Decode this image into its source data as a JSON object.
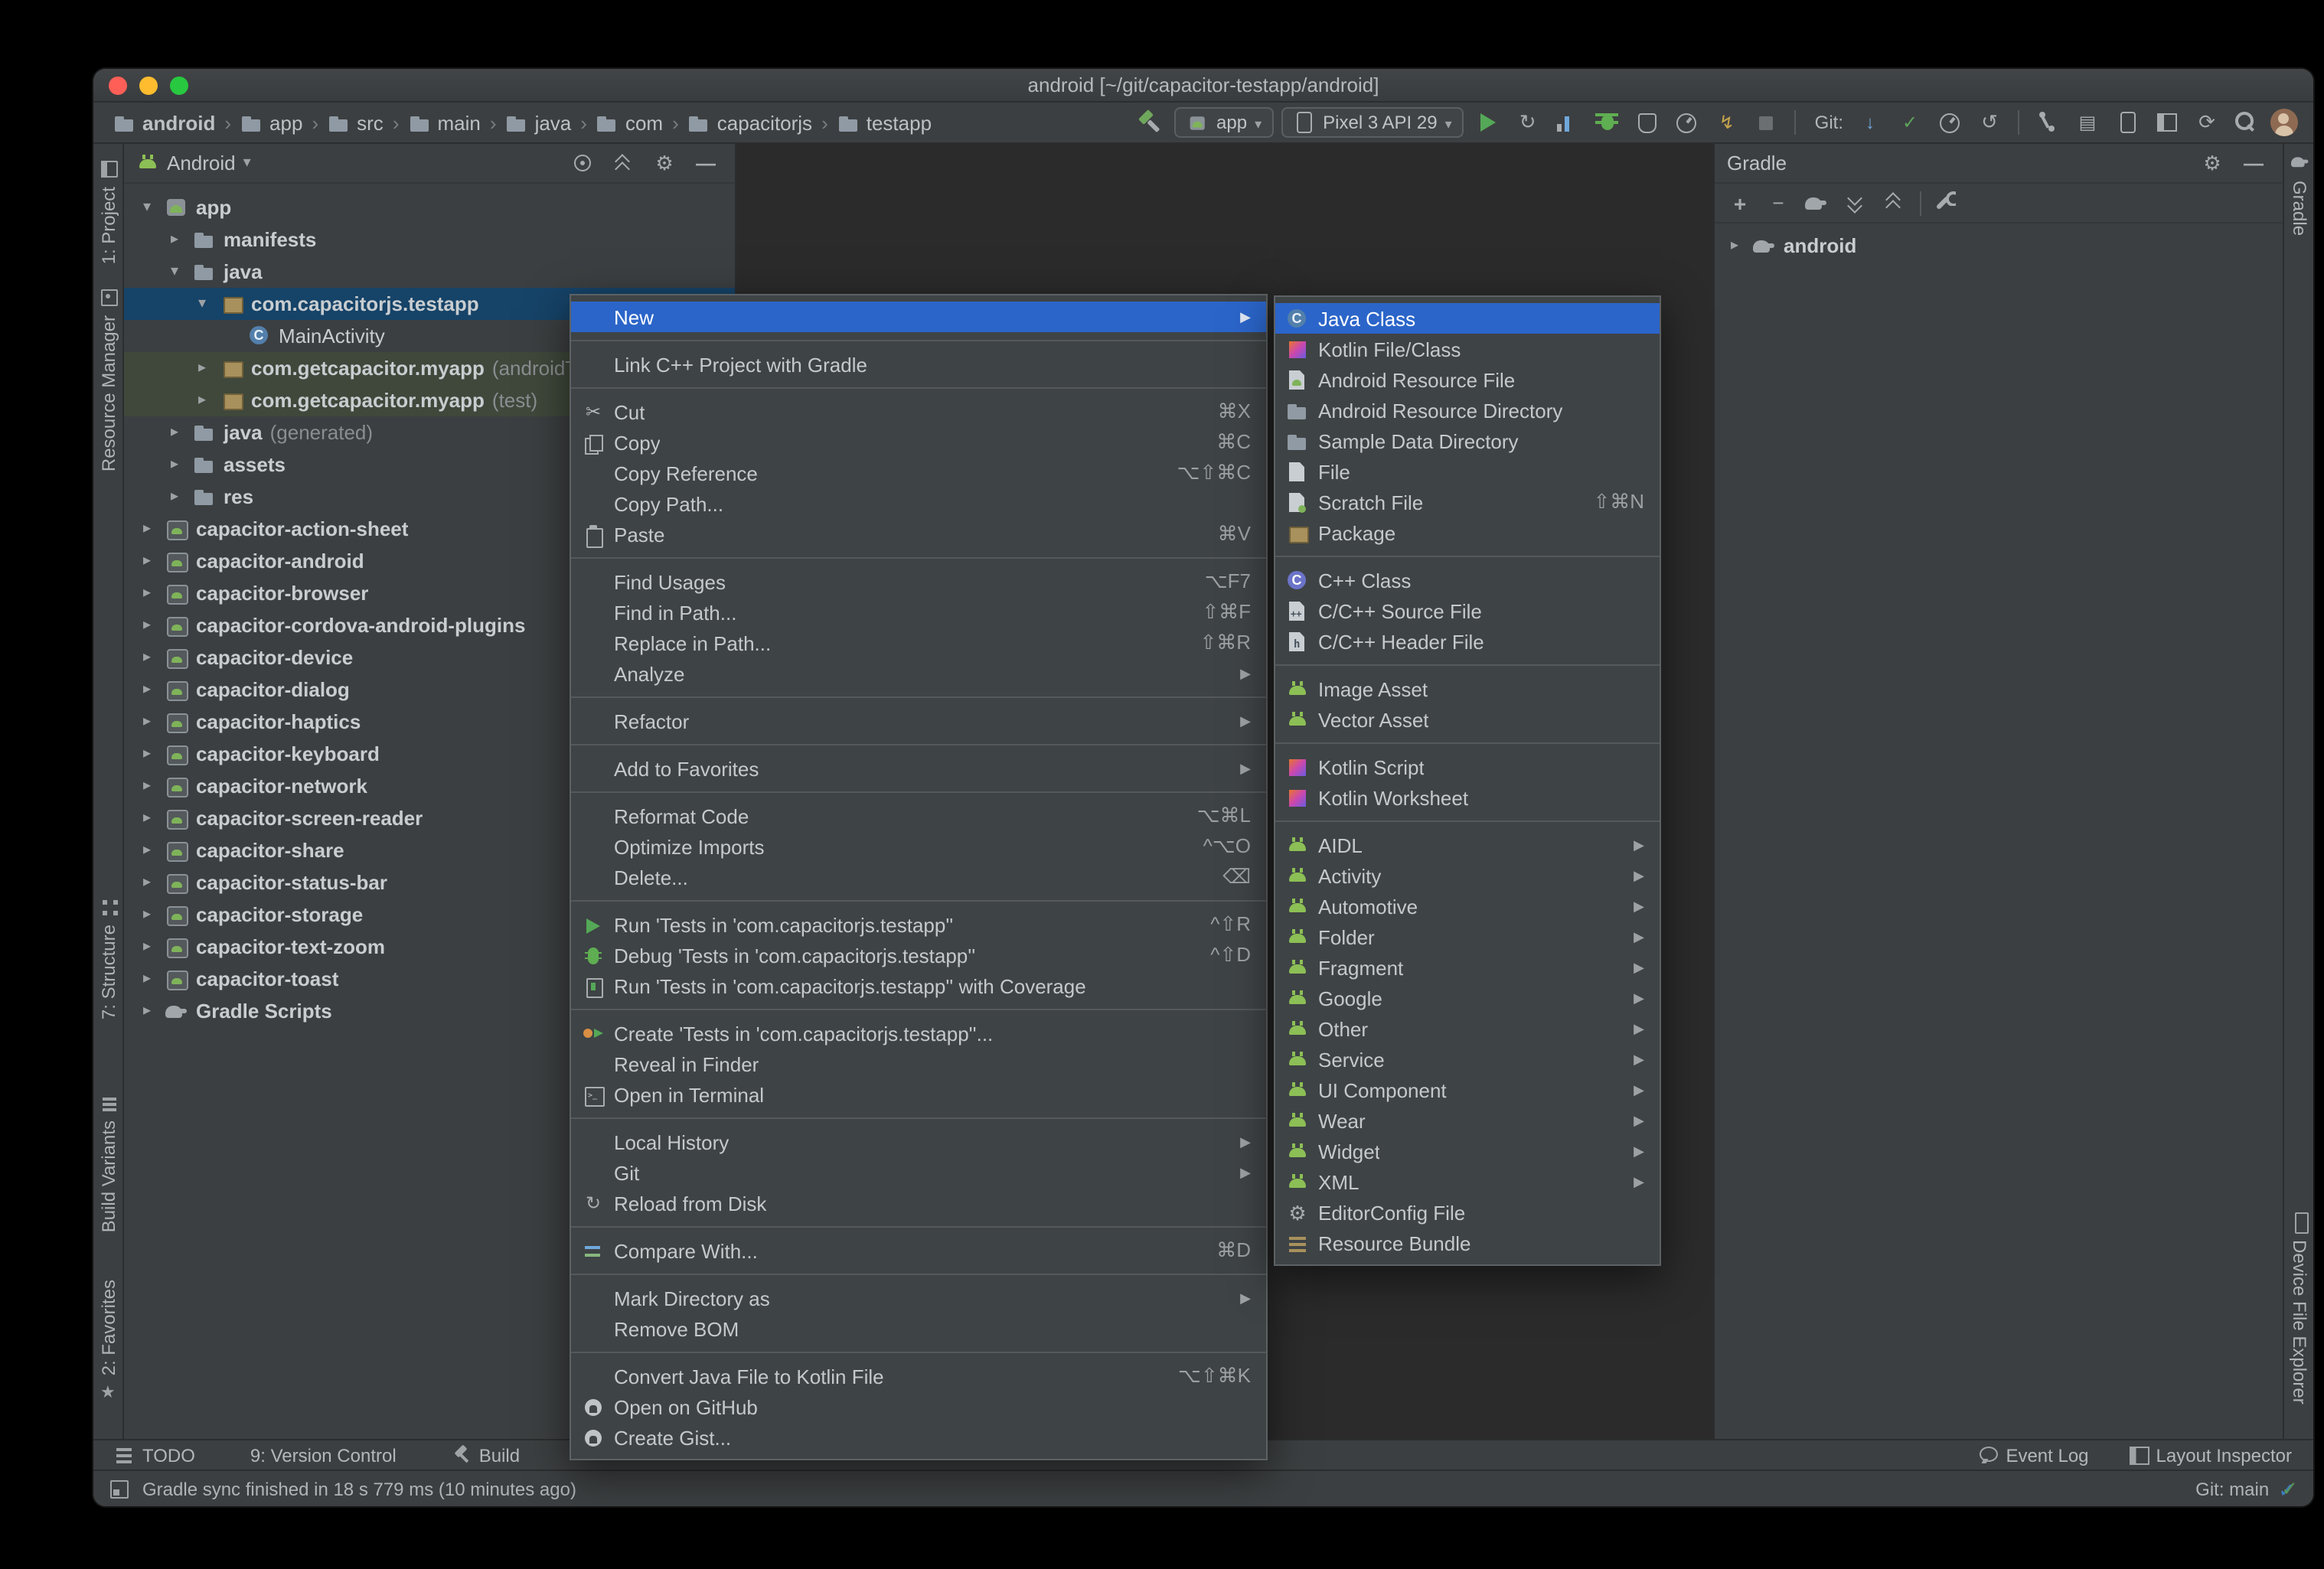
{
  "window": {
    "title": "android [~/git/capacitor-testapp/android]"
  },
  "glyphs": {
    "chevron": "›",
    "caret_down": "▾",
    "expanded": "▾",
    "collapsed": "▸",
    "submenu": "▶"
  },
  "breadcrumbs": [
    "android",
    "app",
    "src",
    "main",
    "java",
    "com",
    "capacitorjs",
    "testapp"
  ],
  "toolbar": {
    "run_config_label": "app",
    "device_label": "Pixel 3 API 29",
    "git_label": "Git:"
  },
  "left_stripe": {
    "project": "1: Project",
    "resource_manager": "Resource Manager",
    "structure": "7: Structure",
    "build_variants": "Build Variants",
    "favorites": "2: Favorites"
  },
  "right_stripe": {
    "gradle": "Gradle",
    "device_file_explorer": "Device File Explorer"
  },
  "project_panel": {
    "view_selector": "Android",
    "tree": [
      {
        "label": "app",
        "level": 0,
        "arrow": "down",
        "icon": "app-module",
        "bold": true
      },
      {
        "label": "manifests",
        "level": 1,
        "arrow": "right",
        "icon": "folder",
        "bold": true
      },
      {
        "label": "java",
        "level": 1,
        "arrow": "down",
        "icon": "folder",
        "bold": true
      },
      {
        "label": "com.capacitorjs.testapp",
        "level": 2,
        "arrow": "down",
        "icon": "package",
        "bold": true,
        "selected": true
      },
      {
        "label": "MainActivity",
        "level": 3,
        "arrow": "none",
        "icon": "class",
        "bold": false
      },
      {
        "label": "com.getcapacitor.myapp",
        "suffix": " (androidTest)",
        "level": 2,
        "arrow": "right",
        "icon": "package",
        "bold": true,
        "scope": "test"
      },
      {
        "label": "com.getcapacitor.myapp",
        "suffix": " (test)",
        "level": 2,
        "arrow": "right",
        "icon": "package",
        "bold": true,
        "scope": "test"
      },
      {
        "label": "java",
        "suffix": " (generated)",
        "level": 1,
        "arrow": "right",
        "icon": "folder",
        "bold": true
      },
      {
        "label": "assets",
        "level": 1,
        "arrow": "right",
        "icon": "folder",
        "bold": true
      },
      {
        "label": "res",
        "level": 1,
        "arrow": "right",
        "icon": "res-folder",
        "bold": true
      },
      {
        "label": "capacitor-action-sheet",
        "level": 0,
        "arrow": "right",
        "icon": "module",
        "bold": true
      },
      {
        "label": "capacitor-android",
        "level": 0,
        "arrow": "right",
        "icon": "module",
        "bold": true
      },
      {
        "label": "capacitor-browser",
        "level": 0,
        "arrow": "right",
        "icon": "module",
        "bold": true
      },
      {
        "label": "capacitor-cordova-android-plugins",
        "level": 0,
        "arrow": "right",
        "icon": "module",
        "bold": true
      },
      {
        "label": "capacitor-device",
        "level": 0,
        "arrow": "right",
        "icon": "module",
        "bold": true
      },
      {
        "label": "capacitor-dialog",
        "level": 0,
        "arrow": "right",
        "icon": "module",
        "bold": true
      },
      {
        "label": "capacitor-haptics",
        "level": 0,
        "arrow": "right",
        "icon": "module",
        "bold": true
      },
      {
        "label": "capacitor-keyboard",
        "level": 0,
        "arrow": "right",
        "icon": "module",
        "bold": true
      },
      {
        "label": "capacitor-network",
        "level": 0,
        "arrow": "right",
        "icon": "module",
        "bold": true
      },
      {
        "label": "capacitor-screen-reader",
        "level": 0,
        "arrow": "right",
        "icon": "module",
        "bold": true
      },
      {
        "label": "capacitor-share",
        "level": 0,
        "arrow": "right",
        "icon": "module",
        "bold": true
      },
      {
        "label": "capacitor-status-bar",
        "level": 0,
        "arrow": "right",
        "icon": "module",
        "bold": true
      },
      {
        "label": "capacitor-storage",
        "level": 0,
        "arrow": "right",
        "icon": "module",
        "bold": true
      },
      {
        "label": "capacitor-text-zoom",
        "level": 0,
        "arrow": "right",
        "icon": "module",
        "bold": true
      },
      {
        "label": "capacitor-toast",
        "level": 0,
        "arrow": "right",
        "icon": "module",
        "bold": true
      },
      {
        "label": "Gradle Scripts",
        "level": 0,
        "arrow": "right",
        "icon": "gradle",
        "bold": true
      }
    ]
  },
  "gradle_panel": {
    "title": "Gradle",
    "tree_item": "android"
  },
  "context_menu": {
    "items": [
      {
        "label": "New",
        "submenu": true,
        "selected": true
      },
      {
        "sep": true
      },
      {
        "label": "Link C++ Project with Gradle"
      },
      {
        "sep": true
      },
      {
        "label": "Cut",
        "icon": "cut",
        "shortcut": "⌘X"
      },
      {
        "label": "Copy",
        "icon": "copy",
        "shortcut": "⌘C"
      },
      {
        "label": "Copy Reference",
        "shortcut": "⌥⇧⌘C"
      },
      {
        "label": "Copy Path..."
      },
      {
        "label": "Paste",
        "icon": "paste",
        "shortcut": "⌘V"
      },
      {
        "sep": true
      },
      {
        "label": "Find Usages",
        "shortcut": "⌥F7"
      },
      {
        "label": "Find in Path...",
        "shortcut": "⇧⌘F"
      },
      {
        "label": "Replace in Path...",
        "shortcut": "⇧⌘R"
      },
      {
        "label": "Analyze",
        "submenu": true
      },
      {
        "sep": true
      },
      {
        "label": "Refactor",
        "submenu": true
      },
      {
        "sep": true
      },
      {
        "label": "Add to Favorites",
        "submenu": true
      },
      {
        "sep": true
      },
      {
        "label": "Reformat Code",
        "shortcut": "⌥⌘L"
      },
      {
        "label": "Optimize Imports",
        "shortcut": "^⌥O"
      },
      {
        "label": "Delete...",
        "shortcut": "⌫"
      },
      {
        "sep": true
      },
      {
        "label": "Run 'Tests in 'com.capacitorjs.testapp''",
        "icon": "run",
        "shortcut": "^⇧R"
      },
      {
        "label": "Debug 'Tests in 'com.capacitorjs.testapp''",
        "icon": "debug",
        "shortcut": "^⇧D"
      },
      {
        "label": "Run 'Tests in 'com.capacitorjs.testapp'' with Coverage",
        "icon": "coverage"
      },
      {
        "sep": true
      },
      {
        "label": "Create 'Tests in 'com.capacitorjs.testapp''...",
        "icon": "tests"
      },
      {
        "label": "Reveal in Finder"
      },
      {
        "label": "Open in Terminal",
        "icon": "terminal"
      },
      {
        "sep": true
      },
      {
        "label": "Local History",
        "submenu": true
      },
      {
        "label": "Git",
        "submenu": true
      },
      {
        "label": "Reload from Disk",
        "icon": "reload"
      },
      {
        "sep": true
      },
      {
        "label": "Compare With...",
        "icon": "compare",
        "shortcut": "⌘D"
      },
      {
        "sep": true
      },
      {
        "label": "Mark Directory as",
        "submenu": true
      },
      {
        "label": "Remove BOM"
      },
      {
        "sep": true
      },
      {
        "label": "Convert Java File to Kotlin File",
        "shortcut": "⌥⇧⌘K"
      },
      {
        "label": "Open on GitHub",
        "icon": "github"
      },
      {
        "label": "Create Gist...",
        "icon": "github"
      }
    ]
  },
  "new_submenu": {
    "items": [
      {
        "label": "Java Class",
        "icon": "class",
        "selected": true
      },
      {
        "label": "Kotlin File/Class",
        "icon": "kotlin"
      },
      {
        "label": "Android Resource File",
        "icon": "android-file"
      },
      {
        "label": "Android Resource Directory",
        "icon": "folder"
      },
      {
        "label": "Sample Data Directory",
        "icon": "folder"
      },
      {
        "label": "File",
        "icon": "file"
      },
      {
        "label": "Scratch File",
        "icon": "scratch",
        "shortcut": "⇧⌘N"
      },
      {
        "label": "Package",
        "icon": "package"
      },
      {
        "sep": true
      },
      {
        "label": "C++ Class",
        "icon": "cpp-class"
      },
      {
        "label": "C/C++ Source File",
        "icon": "cpp-file"
      },
      {
        "label": "C/C++ Header File",
        "icon": "h-file"
      },
      {
        "sep": true
      },
      {
        "label": "Image Asset",
        "icon": "asset"
      },
      {
        "label": "Vector Asset",
        "icon": "asset"
      },
      {
        "sep": true
      },
      {
        "label": "Kotlin Script",
        "icon": "kotlin"
      },
      {
        "label": "Kotlin Worksheet",
        "icon": "kotlin"
      },
      {
        "sep": true
      },
      {
        "label": "AIDL",
        "icon": "android",
        "submenu": true
      },
      {
        "label": "Activity",
        "icon": "android",
        "submenu": true
      },
      {
        "label": "Automotive",
        "icon": "android",
        "submenu": true
      },
      {
        "label": "Folder",
        "icon": "android",
        "submenu": true
      },
      {
        "label": "Fragment",
        "icon": "android",
        "submenu": true
      },
      {
        "label": "Google",
        "icon": "android",
        "submenu": true
      },
      {
        "label": "Other",
        "icon": "android",
        "submenu": true
      },
      {
        "label": "Service",
        "icon": "android",
        "submenu": true
      },
      {
        "label": "UI Component",
        "icon": "android",
        "submenu": true
      },
      {
        "label": "Wear",
        "icon": "android",
        "submenu": true
      },
      {
        "label": "Widget",
        "icon": "android",
        "submenu": true
      },
      {
        "label": "XML",
        "icon": "android",
        "submenu": true
      },
      {
        "label": "EditorConfig File",
        "icon": "gear"
      },
      {
        "label": "Resource Bundle",
        "icon": "bundle"
      }
    ]
  },
  "bottom_bar": {
    "todo": "TODO",
    "version_control": "9: Version Control",
    "build": "Build",
    "event_log": "Event Log",
    "layout_inspector": "Layout Inspector"
  },
  "status_bar": {
    "message": "Gradle sync finished in 18 s 779 ms (10 minutes ago)",
    "git_branch": "Git: main"
  }
}
